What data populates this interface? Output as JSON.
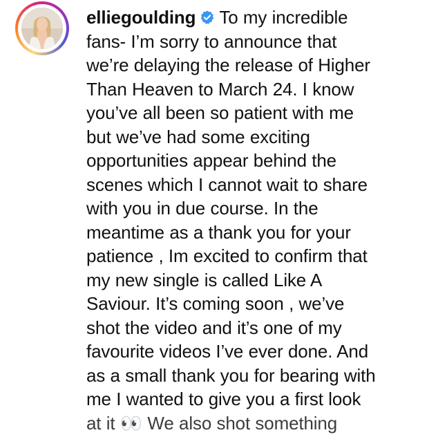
{
  "post": {
    "username": "elliegoulding",
    "verified": true,
    "caption_lines": [
      "To my incredible",
      "fans- I’m sorry to announce that",
      "we’re delaying the release of Higher",
      "Than Heaven to March 24. I know",
      "you’ve all been so patient with me",
      "but we’ve had some exciting",
      "opportunities appear behind the",
      "scenes which I cannot wait to share",
      "with you in due course. In the",
      "meantime as a thank you for your",
      "patience , Im excited to confirm that",
      "my new single is called Like A",
      "Saviour. It’s coming soon , we’ve",
      "shot the video and it’s one of my",
      "favourite videos I’ve ever done. And",
      "as a small thank you for bearing with",
      "me I wanted to give you a first look",
      "at it 👀 We also shot something"
    ]
  },
  "colors": {
    "text": "#111111",
    "verified_badge": "#3897f0",
    "ring_gradient": [
      "#feda75",
      "#fa7e1e",
      "#d62976",
      "#962fbf",
      "#4f5bd5"
    ]
  },
  "icons": {
    "verified": "verified-badge-icon"
  }
}
